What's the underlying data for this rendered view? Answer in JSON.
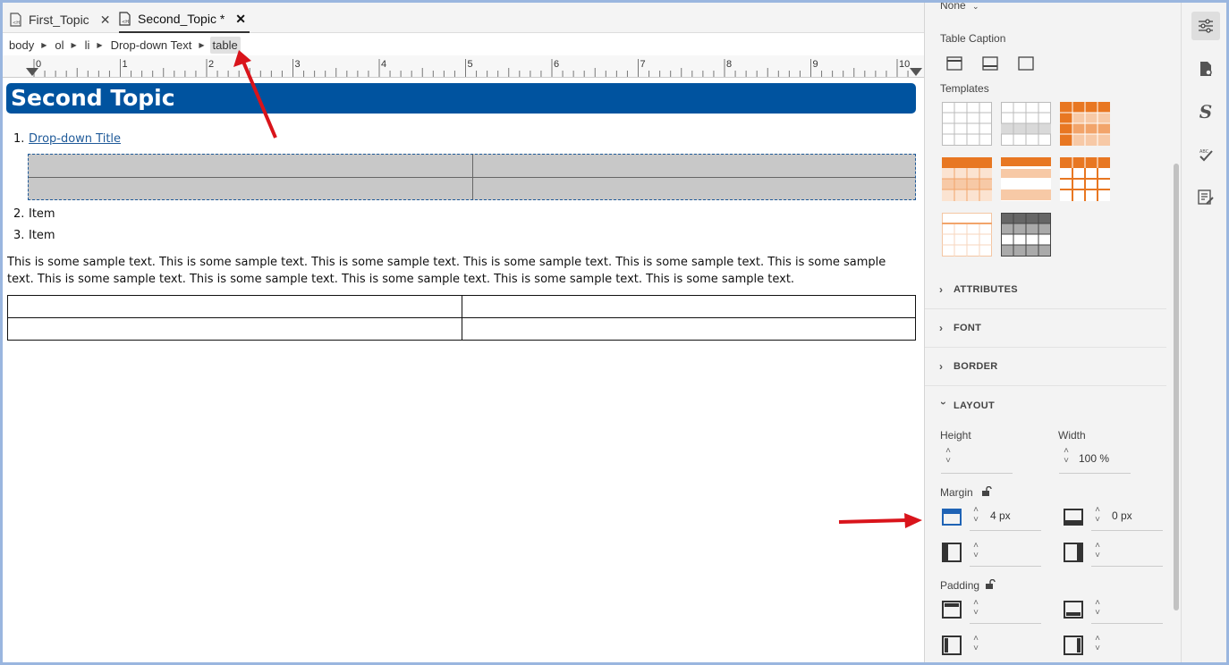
{
  "tabs": [
    {
      "label": "First_Topic",
      "close": "✕"
    },
    {
      "label": "Second_Topic *",
      "close": "✕"
    }
  ],
  "breadcrumb": [
    "body",
    "ol",
    "li",
    "Drop-down Text",
    "table"
  ],
  "ruler": {
    "numbers": [
      "0",
      "1",
      "2",
      "3",
      "4",
      "5",
      "6",
      "7",
      "8",
      "9",
      "10"
    ]
  },
  "document": {
    "title": "Second Topic",
    "list": [
      {
        "num": "1.",
        "text": "Drop-down Title"
      },
      {
        "num": "2.",
        "text": "Item"
      },
      {
        "num": "3.",
        "text": "Item"
      }
    ],
    "sample_text": "This is some sample text. This is some sample text. This is some sample text. This is some sample text. This is some sample text. This is some sample text. This is some sample text. This is some sample text. This is some sample text. This is some sample text. This is some sample text."
  },
  "panel": {
    "top_value": "None",
    "table_caption_label": "Table Caption",
    "templates_label": "Templates",
    "sections": [
      "ATTRIBUTES",
      "FONT",
      "BORDER",
      "LAYOUT"
    ],
    "layout": {
      "height_label": "Height",
      "width_label": "Width",
      "width_value": "100 %",
      "margin_label": "Margin",
      "margin_top": "4 px",
      "margin_bottom": "0 px",
      "padding_label": "Padding"
    }
  },
  "colors": {
    "accent": "#00539f",
    "template_orange": "#e87722",
    "arrow": "#d9141b"
  },
  "rail_icons": [
    "properties-icon",
    "page-settings-icon",
    "styles-icon",
    "spell-check-icon",
    "edit-list-icon"
  ]
}
